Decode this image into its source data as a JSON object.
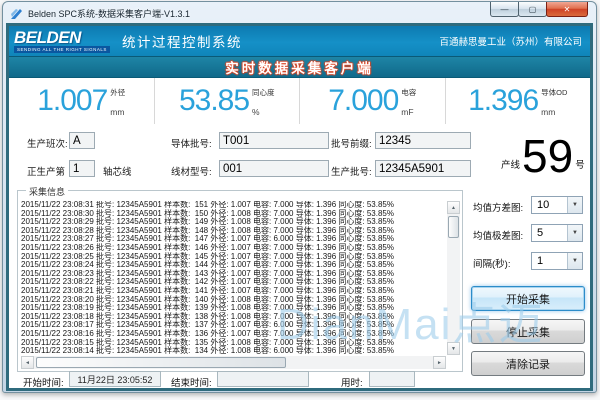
{
  "titlebar": {
    "title": "Belden SPC系统-数据采集客户端-V1.3.1",
    "minimize_icon": "—",
    "maximize_icon": "▢",
    "close_icon": "✕"
  },
  "brand": {
    "logo_text": "BELDEN",
    "logo_tagline": "SENDING ALL THE RIGHT SIGNALS",
    "system_name": "统计过程控制系统",
    "company_name": "百通赫思曼工业（苏州）有限公司"
  },
  "banner": {
    "title": "实时数据采集客户端"
  },
  "metrics": [
    {
      "value": "1.007",
      "label": "外径",
      "unit": "mm"
    },
    {
      "value": "53.85",
      "label": "同心度",
      "unit": "%"
    },
    {
      "value": "7.000",
      "label": "电容",
      "unit": "mF"
    },
    {
      "value": "1.396",
      "label": "导体OD",
      "unit": "mm"
    }
  ],
  "form": {
    "shift_label": "生产班次:",
    "shift_value": "A",
    "producing_label": "正生产第",
    "producing_value": "1",
    "producing_suffix": "轴芯线",
    "conductor_batch_label": "导体批号:",
    "conductor_batch_value": "T001",
    "wire_model_label": "线材型号:",
    "wire_model_value": "001",
    "batch_prefix_label": "批号前缀:",
    "batch_prefix_value": "12345",
    "production_batch_label": "生产批号:",
    "production_batch_value": "12345A5901",
    "line_prefix": "产线",
    "line_number": "59",
    "line_suffix": "号"
  },
  "log": {
    "group_title": "采集信息",
    "rows": [
      "2015/11/22 23:08:31 批号: 12345A5901 样本数:  151 外径: 1.007 电容: 7.000 导体: 1.396 同心度: 53.85%",
      "2015/11/22 23:08:30 批号: 12345A5901 样本数:  150 外径: 1.008 电容: 7.000 导体: 1.396 同心度: 53.85%",
      "2015/11/22 23:08:29 批号: 12345A5901 样本数:  149 外径: 1.008 电容: 7.000 导体: 1.396 同心度: 53.85%",
      "2015/11/22 23:08:28 批号: 12345A5901 样本数:  148 外径: 1.008 电容: 7.000 导体: 1.396 同心度: 53.85%",
      "2015/11/22 23:08:27 批号: 12345A5901 样本数:  147 外径: 1.007 电容: 6.000 导体: 1.396 同心度: 53.85%",
      "2015/11/22 23:08:26 批号: 12345A5901 样本数:  146 外径: 1.007 电容: 7.000 导体: 1.396 同心度: 53.85%",
      "2015/11/22 23:08:25 批号: 12345A5901 样本数:  145 外径: 1.007 电容: 7.000 导体: 1.396 同心度: 53.85%",
      "2015/11/22 23:08:24 批号: 12345A5901 样本数:  144 外径: 1.007 电容: 7.000 导体: 1.396 同心度: 53.85%",
      "2015/11/22 23:08:23 批号: 12345A5901 样本数:  143 外径: 1.007 电容: 7.000 导体: 1.396 同心度: 53.85%",
      "2015/11/22 23:08:22 批号: 12345A5901 样本数:  142 外径: 1.007 电容: 7.000 导体: 1.396 同心度: 53.85%",
      "2015/11/22 23:08:21 批号: 12345A5901 样本数:  141 外径: 1.007 电容: 7.000 导体: 1.396 同心度: 53.85%",
      "2015/11/22 23:08:20 批号: 12345A5901 样本数:  140 外径: 1.008 电容: 7.000 导体: 1.396 同心度: 53.85%",
      "2015/11/22 23:08:19 批号: 12345A5901 样本数:  139 外径: 1.008 电容: 7.000 导体: 1.396 同心度: 53.85%",
      "2015/11/22 23:08:18 批号: 12345A5901 样本数:  138 外径: 1.008 电容: 7.000 导体: 1.396 同心度: 53.85%",
      "2015/11/22 23:08:17 批号: 12345A5901 样本数:  137 外径: 1.007 电容: 6.000 导体: 1.396 同心度: 53.85%",
      "2015/11/22 23:08:16 批号: 12345A5901 样本数:  136 外径: 1.007 电容: 7.000 导体: 1.396 同心度: 53.85%",
      "2015/11/22 23:08:15 批号: 12345A5901 样本数:  135 外径: 1.008 电容: 7.000 导体: 1.396 同心度: 53.85%",
      "2015/11/22 23:08:14 批号: 12345A5901 样本数:  134 外径: 1.008 电容: 6.000 导体: 1.396 同心度: 53.85%"
    ]
  },
  "settings": {
    "mean_variance_label": "均值方差图:",
    "mean_variance_value": "10",
    "mean_range_label": "均值极差图:",
    "mean_range_value": "5",
    "interval_label": "间隔(秒):",
    "interval_value": "1",
    "dropdown_arrow_icon": "▼"
  },
  "buttons": {
    "start": "开始采集",
    "stop": "停止采集",
    "clear": "清除记录"
  },
  "footer": {
    "start_time_label": "开始时间:",
    "start_time_value": "11月22日 23:05:52",
    "end_time_label": "结束时间:",
    "end_time_value": "",
    "elapsed_label": "用时:",
    "elapsed_value": ""
  },
  "watermark": "DianMai点迈",
  "colors": {
    "brand_blue": "#1084bd",
    "banner_teal": "#16779a",
    "client_border_teal": "#2f6b7d",
    "metric_blue": "#2aa2db",
    "banner_text_red_glow": "#dd4422",
    "watermark_blue": "#9bcceA"
  }
}
